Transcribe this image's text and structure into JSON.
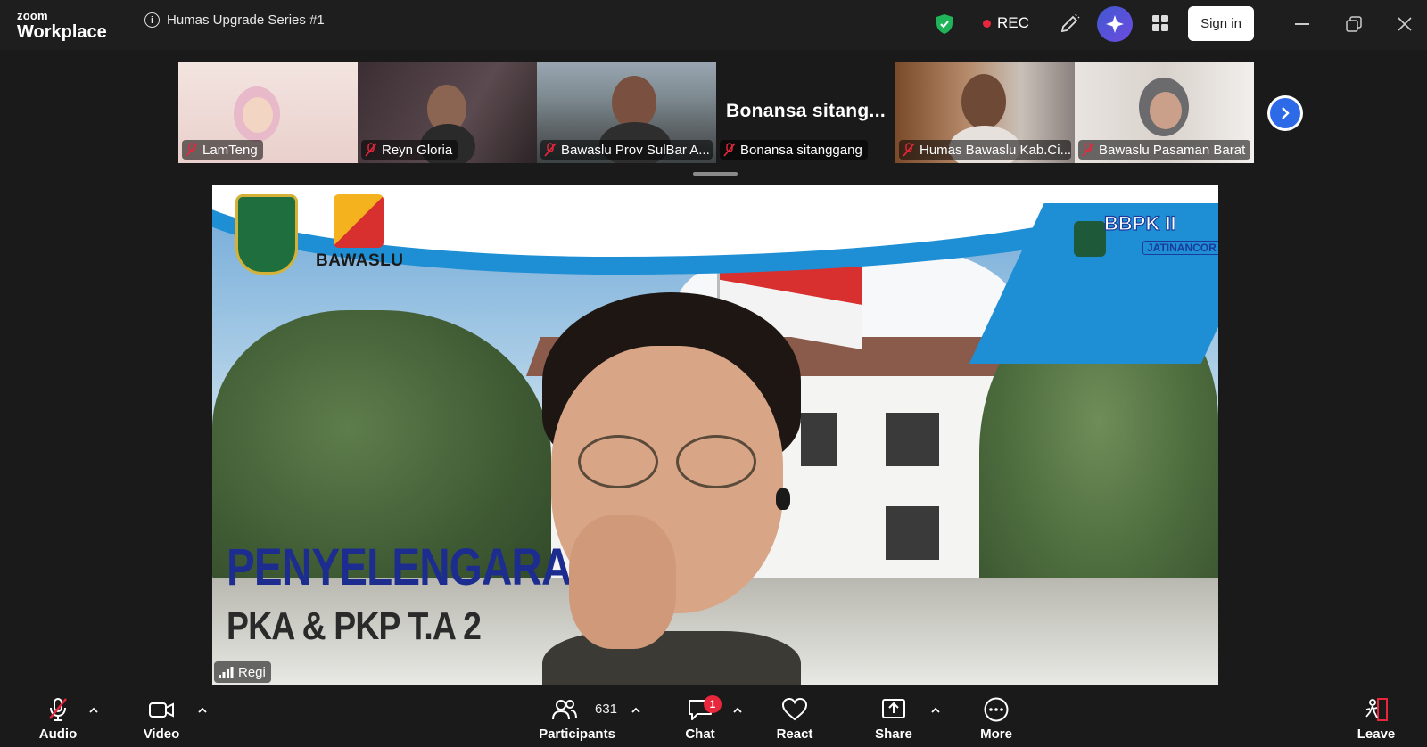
{
  "app": {
    "logo_small": "zoom",
    "logo_big": "Workplace"
  },
  "meeting": {
    "title": "Humas Upgrade Series #1"
  },
  "header": {
    "rec_label": "REC",
    "signin_label": "Sign in"
  },
  "gallery": {
    "participants": [
      {
        "name": "LamTeng"
      },
      {
        "name": "Reyn Gloria"
      },
      {
        "name": "Bawaslu Prov SulBar A..."
      },
      {
        "name": "Bonansa sitanggang",
        "video_text": "Bonansa  sitang..."
      },
      {
        "name": "Humas Bawaslu Kab.Ci..."
      },
      {
        "name": "Bawaslu Pasaman Barat"
      }
    ]
  },
  "main_video": {
    "speaker_name": "Regi",
    "background_text": {
      "org": "BAWASLU",
      "title_line1": "PENYELENGARA",
      "title_line2": "PKA & PKP T.A 2",
      "brand": "BBPK II",
      "brand_sub": "JATINANCOR"
    }
  },
  "toolbar": {
    "audio": "Audio",
    "video": "Video",
    "participants": "Participants",
    "participants_count": "631",
    "chat": "Chat",
    "chat_badge": "1",
    "react": "React",
    "share": "Share",
    "more": "More",
    "leave": "Leave"
  },
  "colors": {
    "accent_blue": "#2d6ae8",
    "rec_red": "#e8273c",
    "shield_green": "#1fb45a",
    "background": "#1a1a1a"
  }
}
